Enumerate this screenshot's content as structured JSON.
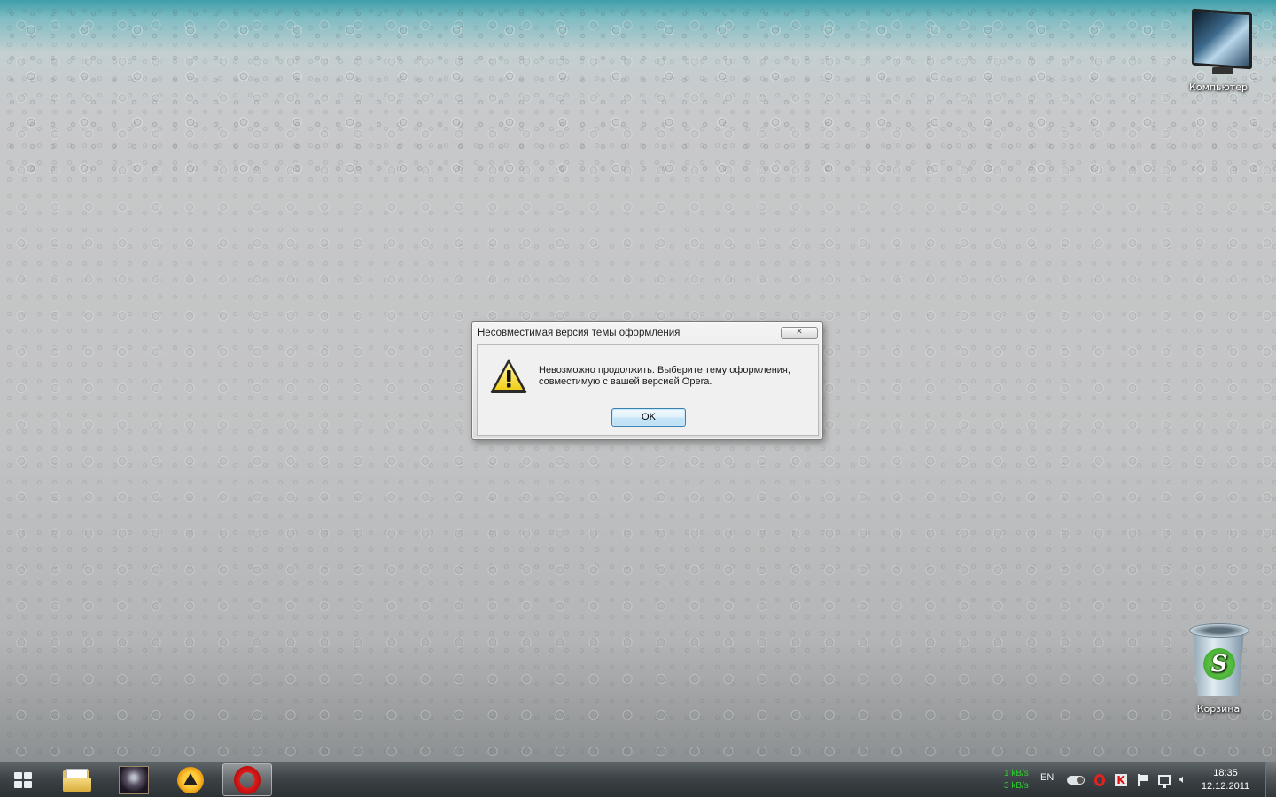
{
  "desktop": {
    "icons": [
      {
        "label": "Компьютер",
        "icon": "computer-icon"
      },
      {
        "label": "Корзина",
        "icon": "recycle-bin-icon"
      }
    ]
  },
  "dialog": {
    "title": "Несовместимая версия темы оформления",
    "close_label": "✕",
    "message_line1": "Невозможно продолжить. Выберите тему оформления,",
    "message_line2": "совместимую с вашей версией Opera.",
    "ok_label": "OK",
    "icon": "warning-icon"
  },
  "taskbar": {
    "pinned": [
      {
        "name": "explorer",
        "icon": "folder-icon"
      },
      {
        "name": "game",
        "icon": "game-icon"
      },
      {
        "name": "aimp",
        "icon": "aimp-icon"
      },
      {
        "name": "opera",
        "icon": "opera-icon",
        "active": true
      }
    ],
    "net_up": "1 kB/s",
    "net_down": "3 kB/s",
    "language": "EN",
    "time": "18:35",
    "date": "12.12.2011"
  },
  "colors": {
    "net_speed": "#2fd12f",
    "ok_border": "#3c7fb1"
  }
}
